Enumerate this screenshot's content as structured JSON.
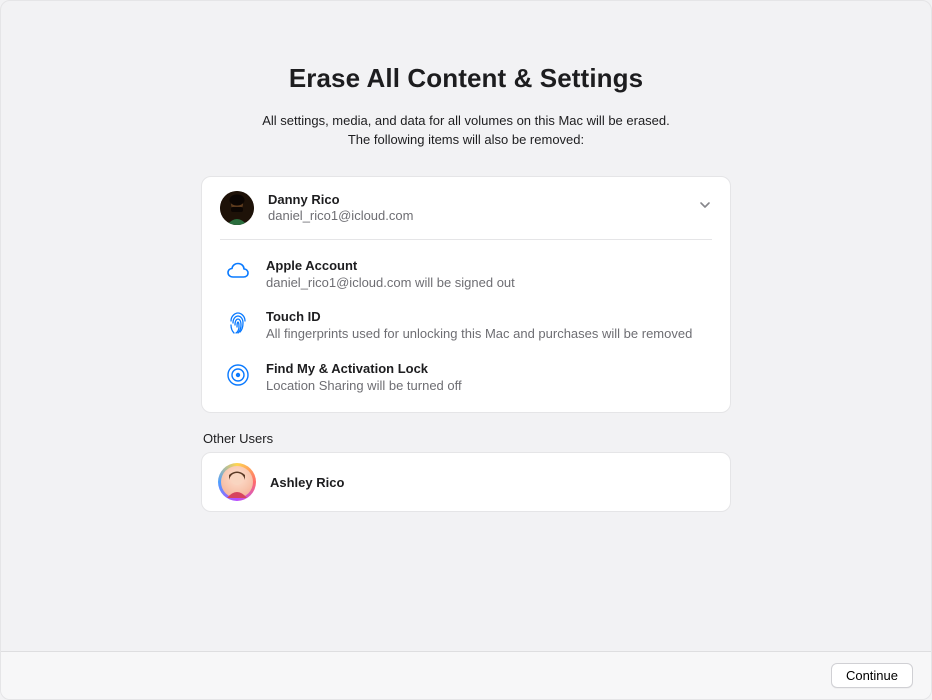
{
  "title": "Erase All Content & Settings",
  "subtitle_line1": "All settings, media, and data for all volumes on this Mac will be erased.",
  "subtitle_line2": "The following items will also be removed:",
  "user": {
    "name": "Danny Rico",
    "email": "daniel_rico1@icloud.com"
  },
  "items": [
    {
      "icon": "cloud-icon",
      "title": "Apple Account",
      "desc": "daniel_rico1@icloud.com will be signed out"
    },
    {
      "icon": "fingerprint-icon",
      "title": "Touch ID",
      "desc": "All fingerprints used for unlocking this Mac and purchases will be removed"
    },
    {
      "icon": "findmy-icon",
      "title": "Find My & Activation Lock",
      "desc": "Location Sharing will be turned off"
    }
  ],
  "other_users_label": "Other Users",
  "other_users": [
    {
      "name": "Ashley Rico"
    }
  ],
  "footer": {
    "continue_label": "Continue"
  }
}
